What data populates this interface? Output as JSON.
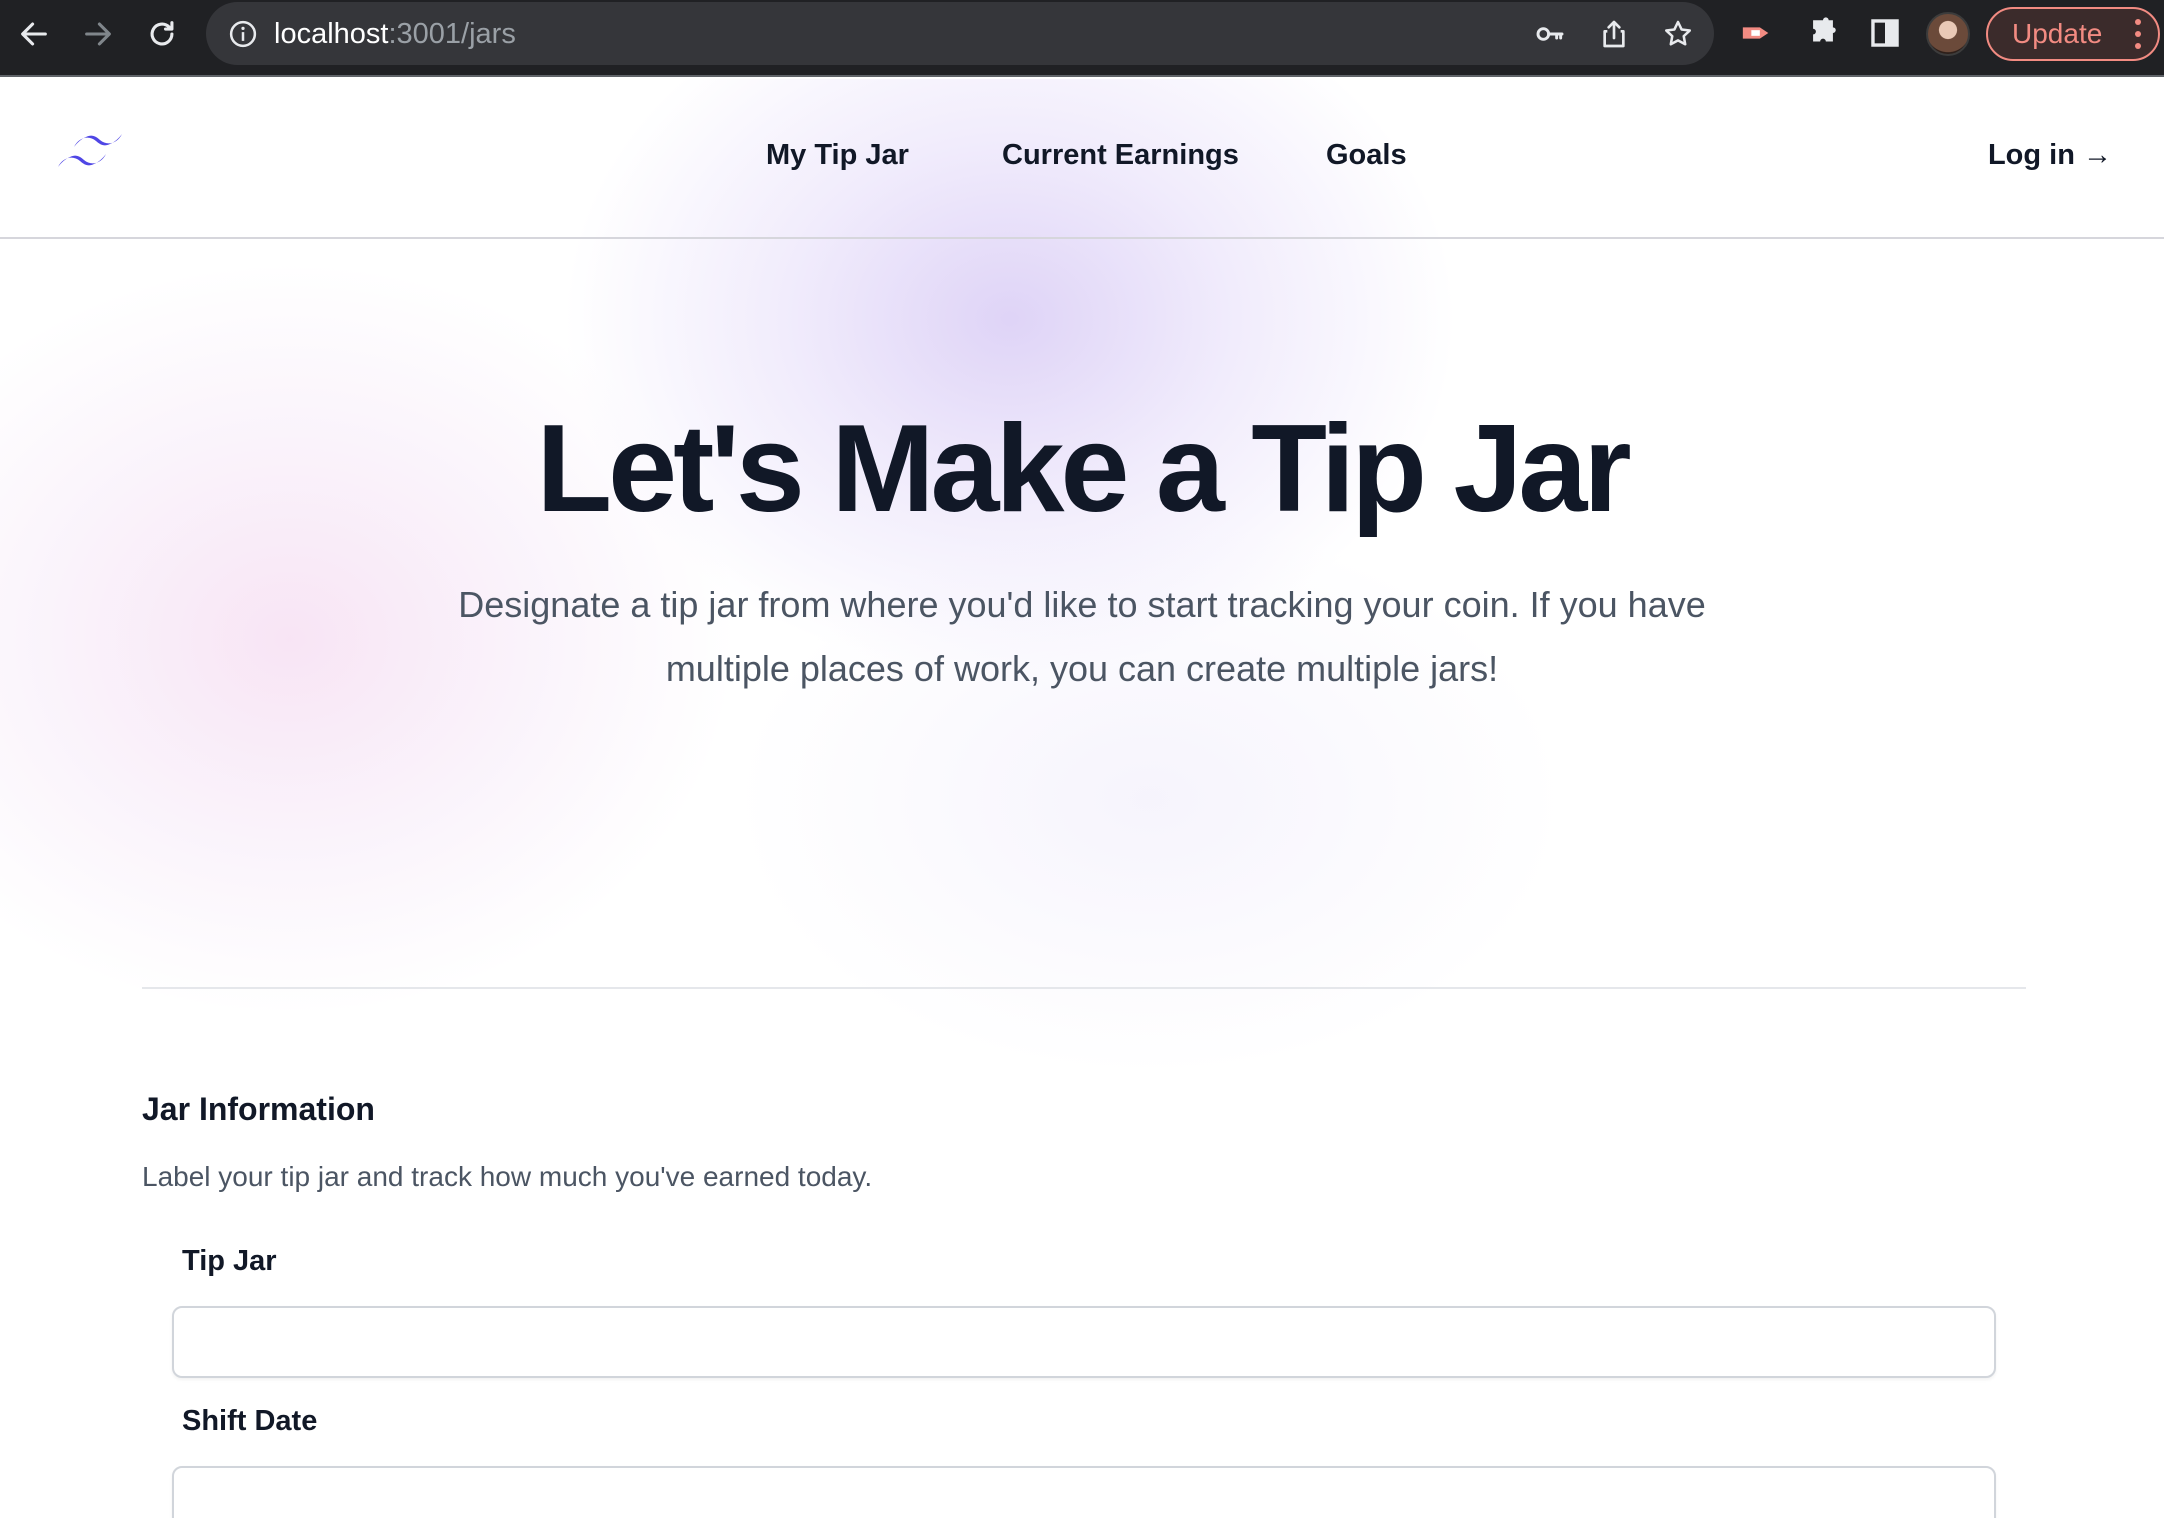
{
  "browser": {
    "url_host": "localhost",
    "url_path": ":3001/jars",
    "update_label": "Update"
  },
  "nav": {
    "links": [
      "My Tip Jar",
      "Current Earnings",
      "Goals"
    ],
    "login_label": "Log in →"
  },
  "hero": {
    "title": "Let's Make a Tip Jar",
    "subtitle_line1": "Designate a tip jar from where you'd like to start tracking your coin. If you have",
    "subtitle_line2": "multiple places of work, you can create multiple jars!"
  },
  "form": {
    "section_title": "Jar Information",
    "section_desc": "Label your tip jar and track how much you've earned today.",
    "fields": [
      {
        "label": "Tip Jar",
        "value": ""
      },
      {
        "label": "Shift Date",
        "value": ""
      }
    ]
  },
  "colors": {
    "brand": "#4f46e5",
    "text": "#111827",
    "muted": "#4b5563",
    "update": "#f28b82"
  }
}
